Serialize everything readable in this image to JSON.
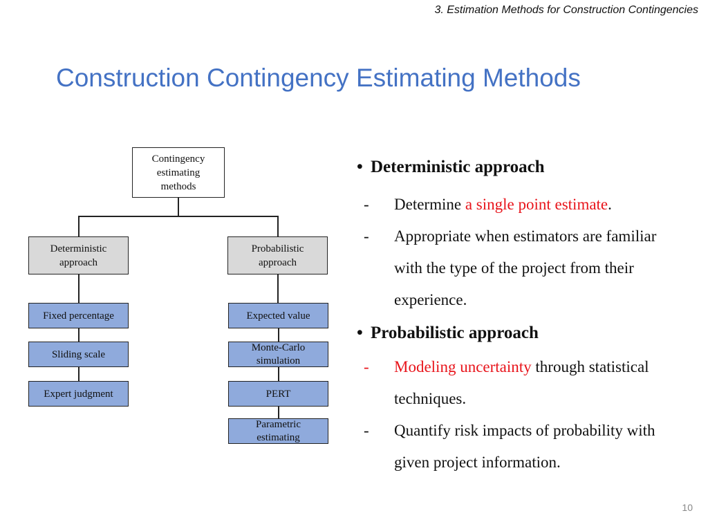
{
  "header": {
    "section": "3. Estimation Methods for Construction Contingencies"
  },
  "title": "Construction Contingency Estimating Methods",
  "diagram": {
    "root": "Contingency estimating methods",
    "branches": [
      {
        "label": "Deterministic approach",
        "methods": [
          "Fixed percentage",
          "Sliding scale",
          "Expert judgment"
        ]
      },
      {
        "label": "Probabilistic approach",
        "methods": [
          "Expected value",
          "Monte-Carlo simulation",
          "PERT",
          "Parametric estimating"
        ]
      }
    ]
  },
  "bullets": [
    {
      "heading": "Deterministic approach",
      "items": [
        {
          "dash": "-",
          "parts": [
            {
              "text": "Determine ",
              "highlight": false
            },
            {
              "text": "a single point estimate",
              "highlight": true
            },
            {
              "text": ".",
              "highlight": false
            }
          ],
          "lines": [
            "Determine a single point estimate."
          ]
        },
        {
          "dash": "-",
          "lines": [
            "Appropriate when estimators are familiar",
            "with the type of the project from their",
            "experience."
          ]
        }
      ]
    },
    {
      "heading": "Probabilistic approach",
      "items": [
        {
          "dash": "-",
          "dash_highlight": true,
          "parts": [
            {
              "text": "Modeling uncertainty",
              "highlight": true
            },
            {
              "text": " through statistical",
              "highlight": false
            }
          ],
          "lines": [
            "Modeling uncertainty through statistical",
            "techniques."
          ]
        },
        {
          "dash": "-",
          "lines": [
            "Quantify risk impacts of probability with",
            "given project information."
          ]
        }
      ]
    }
  ],
  "bullet_char": "•",
  "highlight_color": "#e8141b",
  "title_color": "#4472c4",
  "page_number": "10"
}
